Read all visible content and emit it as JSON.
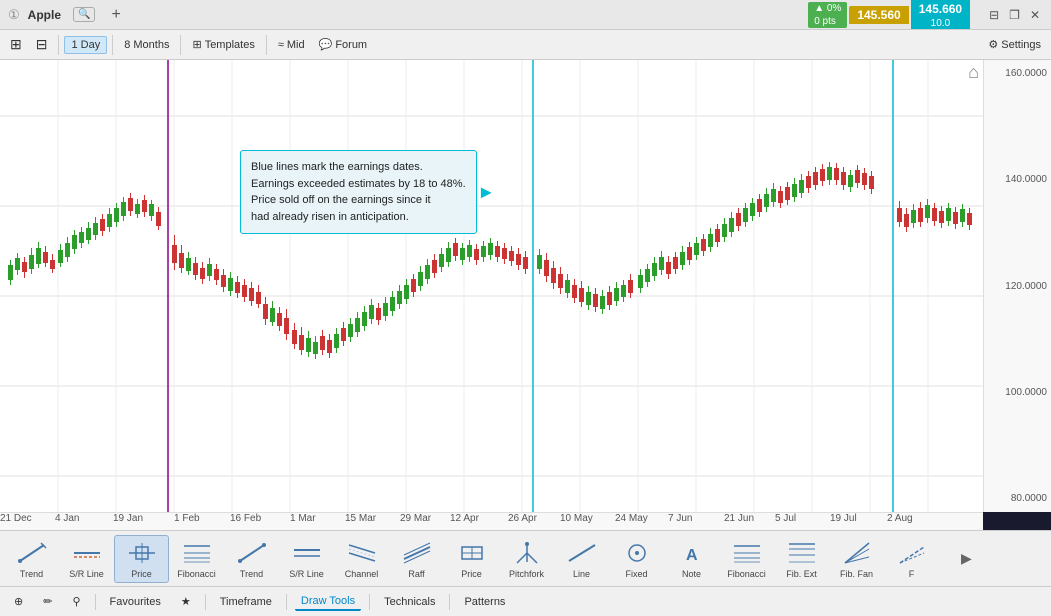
{
  "titlebar": {
    "icon": "①",
    "app_name": "Apple",
    "new_tab": "+",
    "change_pct": "▲ 0%",
    "change_pts": "0 pts",
    "price1": "145.560",
    "price2": "145.660",
    "price_sub": "10.0",
    "win_controls": [
      "⊟",
      "❐",
      "✕"
    ]
  },
  "toolbar": {
    "grid_btn": "⊞",
    "layout_btn": "⊟",
    "timeframe": "1 Day",
    "months": "8 Months",
    "templates_icon": "⊞",
    "templates": "Templates",
    "mid_icon": "≈",
    "mid": "Mid",
    "forum_icon": "💬",
    "forum": "Forum",
    "settings_icon": "⚙",
    "settings": "Settings"
  },
  "xaxis": {
    "labels": [
      "21 Dec",
      "4 Jan",
      "19 Jan",
      "1 Feb",
      "16 Feb",
      "1 Mar",
      "15 Mar",
      "29 Mar",
      "12 Apr",
      "26 Apr",
      "10 May",
      "24 May",
      "7 Jun",
      "21 Jun",
      "5 Jul",
      "19 Jul",
      "2 Aug"
    ]
  },
  "yaxis": {
    "labels": [
      "160.0000",
      "140.0000",
      "120.0000",
      "100.0000",
      "80.0000"
    ]
  },
  "chart": {
    "tooltip": {
      "text": "Blue lines mark the earnings dates.\nEarnings exceeded estimates by 18 to 48%.\nPrice sold off on the earnings since it had already risen in anticipation."
    }
  },
  "bottom_tools": [
    {
      "id": "trend1",
      "label": "Trend",
      "icon": "⟋"
    },
    {
      "id": "sr_line1",
      "label": "S/R Line",
      "icon": "═"
    },
    {
      "id": "price_tool",
      "label": "Price",
      "icon": "⊕",
      "active": true
    },
    {
      "id": "fibonacci1",
      "label": "Fibonacci",
      "icon": "⟿"
    },
    {
      "id": "trend2",
      "label": "Trend",
      "icon": "⟋"
    },
    {
      "id": "sr_line2",
      "label": "S/R Line",
      "icon": "═"
    },
    {
      "id": "channel",
      "label": "Channel",
      "icon": "⥈"
    },
    {
      "id": "raff",
      "label": "Raff",
      "icon": "↗"
    },
    {
      "id": "price_tool2",
      "label": "Price",
      "icon": "⊕"
    },
    {
      "id": "pitchfork",
      "label": "Pitchfork",
      "icon": "⑃"
    },
    {
      "id": "line",
      "label": "Line",
      "icon": "╱"
    },
    {
      "id": "fixed",
      "label": "Fixed",
      "icon": "◉"
    },
    {
      "id": "note",
      "label": "Note",
      "icon": "A"
    },
    {
      "id": "fibonacci2",
      "label": "Fibonacci",
      "icon": "⟿"
    },
    {
      "id": "fib_ext",
      "label": "Fib. Ext",
      "icon": "⟿"
    },
    {
      "id": "fib_fan",
      "label": "Fib. Fan",
      "icon": "⟿"
    },
    {
      "id": "f",
      "label": "F",
      "icon": "⟿"
    }
  ],
  "statusbar": {
    "cursor_icon": "⊕",
    "pen_icon": "✏",
    "magnet_icon": "⚲",
    "tabs": [
      "Favourites",
      "★",
      "Timeframe",
      "Draw Tools",
      "Technicals",
      "Patterns"
    ]
  }
}
